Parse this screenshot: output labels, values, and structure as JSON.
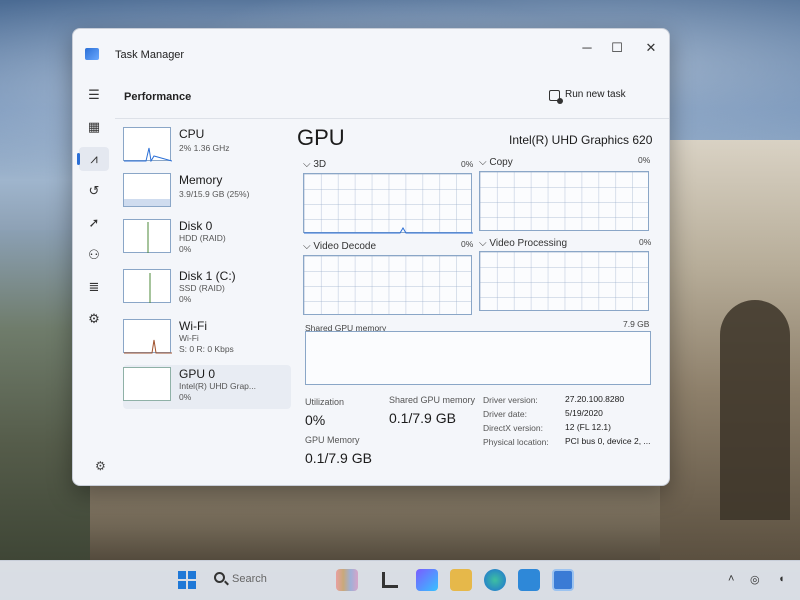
{
  "window": {
    "title": "Task Manager",
    "controls": {
      "minimize": "─",
      "maximize": "☐",
      "close": "✕"
    }
  },
  "header": {
    "title": "Performance",
    "run_new_task": "Run new task",
    "more": "•••"
  },
  "sidebar_icons": [
    "hamburger-icon",
    "processes-icon",
    "performance-icon",
    "app-history-icon",
    "startup-apps-icon",
    "users-icon",
    "details-icon",
    "services-icon",
    "settings-icon"
  ],
  "perf_items": [
    {
      "name": "CPU",
      "line1": "2% 1.36 GHz",
      "line2": ""
    },
    {
      "name": "Memory",
      "line1": "3.9/15.9 GB (25%)",
      "line2": ""
    },
    {
      "name": "Disk 0",
      "line1": "HDD (RAID)",
      "line2": "0%"
    },
    {
      "name": "Disk 1 (C:)",
      "line1": "SSD (RAID)",
      "line2": "0%"
    },
    {
      "name": "Wi-Fi",
      "line1": "Wi-Fi",
      "line2": "S: 0 R: 0 Kbps"
    },
    {
      "name": "GPU 0",
      "line1": "Intel(R) UHD Grap...",
      "line2": "0%"
    }
  ],
  "gpu": {
    "title": "GPU",
    "model": "Intel(R) UHD Graphics 620",
    "engines": [
      {
        "label": "3D",
        "percent": "0%"
      },
      {
        "label": "Copy",
        "percent": "0%"
      },
      {
        "label": "Video Decode",
        "percent": "0%"
      },
      {
        "label": "Video Processing",
        "percent": "0%"
      }
    ],
    "shared_memory_label": "Shared GPU memory",
    "shared_memory_max": "7.9 GB",
    "stats": {
      "utilization_label": "Utilization",
      "utilization": "0%",
      "shared_label": "Shared GPU memory",
      "shared": "0.1/7.9 GB",
      "gpu_memory_label": "GPU Memory",
      "gpu_memory": "0.1/7.9 GB"
    },
    "driver": {
      "version_label": "Driver version:",
      "version": "27.20.100.8280",
      "date_label": "Driver date:",
      "date": "5/19/2020",
      "directx_label": "DirectX version:",
      "directx": "12 (FL 12.1)",
      "location_label": "Physical location:",
      "location": "PCI bus 0, device 2, ..."
    }
  },
  "taskbar": {
    "search": "Search",
    "colors": {
      "start": "#1e78d7"
    }
  }
}
